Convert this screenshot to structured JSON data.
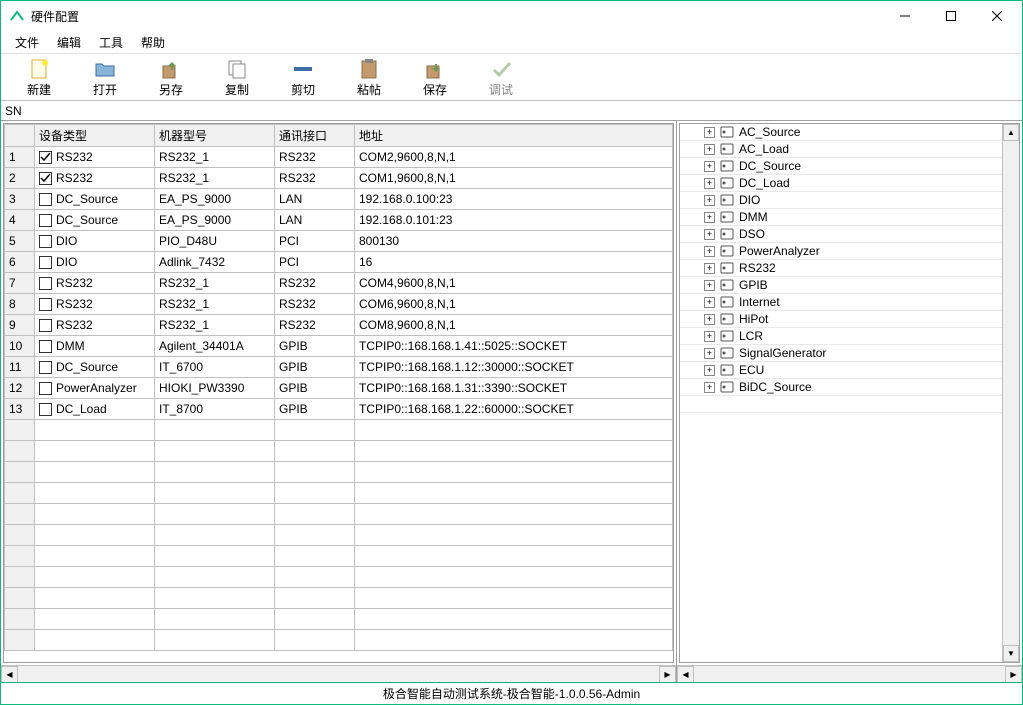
{
  "window": {
    "title": "硬件配置"
  },
  "menu": {
    "file": "文件",
    "edit": "编辑",
    "tool": "工具",
    "help": "帮助"
  },
  "toolbar": {
    "new": "新建",
    "open": "打开",
    "saveas": "另存",
    "copy": "复制",
    "cut": "剪切",
    "paste": "粘帖",
    "save": "保存",
    "debug": "调试"
  },
  "sn_label": "SN",
  "columns": {
    "type": "设备类型",
    "model": "机器型号",
    "comm": "通讯接口",
    "addr": "地址"
  },
  "rows": [
    {
      "n": "1",
      "checked": true,
      "type": "RS232",
      "model": "RS232_1",
      "comm": "RS232",
      "addr": "COM2,9600,8,N,1"
    },
    {
      "n": "2",
      "checked": true,
      "type": "RS232",
      "model": "RS232_1",
      "comm": "RS232",
      "addr": "COM1,9600,8,N,1"
    },
    {
      "n": "3",
      "checked": false,
      "type": "DC_Source",
      "model": "EA_PS_9000",
      "comm": "LAN",
      "addr": "192.168.0.100:23"
    },
    {
      "n": "4",
      "checked": false,
      "type": "DC_Source",
      "model": "EA_PS_9000",
      "comm": "LAN",
      "addr": "192.168.0.101:23"
    },
    {
      "n": "5",
      "checked": false,
      "type": "DIO",
      "model": "PIO_D48U",
      "comm": "PCI",
      "addr": "800130"
    },
    {
      "n": "6",
      "checked": false,
      "type": "DIO",
      "model": "Adlink_7432",
      "comm": "PCI",
      "addr": "16"
    },
    {
      "n": "7",
      "checked": false,
      "type": "RS232",
      "model": "RS232_1",
      "comm": "RS232",
      "addr": "COM4,9600,8,N,1"
    },
    {
      "n": "8",
      "checked": false,
      "type": "RS232",
      "model": "RS232_1",
      "comm": "RS232",
      "addr": "COM6,9600,8,N,1"
    },
    {
      "n": "9",
      "checked": false,
      "type": "RS232",
      "model": "RS232_1",
      "comm": "RS232",
      "addr": "COM8,9600,8,N,1"
    },
    {
      "n": "10",
      "checked": false,
      "type": "DMM",
      "model": "Agilent_34401A",
      "comm": "GPIB",
      "addr": "TCPIP0::168.168.1.41::5025::SOCKET"
    },
    {
      "n": "11",
      "checked": false,
      "type": "DC_Source",
      "model": "IT_6700",
      "comm": "GPIB",
      "addr": "TCPIP0::168.168.1.12::30000::SOCKET"
    },
    {
      "n": "12",
      "checked": false,
      "type": "PowerAnalyzer",
      "model": "HIOKI_PW3390",
      "comm": "GPIB",
      "addr": "TCPIP0::168.168.1.31::3390::SOCKET"
    },
    {
      "n": "13",
      "checked": false,
      "type": "DC_Load",
      "model": "IT_8700",
      "comm": "GPIB",
      "addr": "TCPIP0::168.168.1.22::60000::SOCKET"
    }
  ],
  "tree": [
    "AC_Source",
    "AC_Load",
    "DC_Source",
    "DC_Load",
    "DIO",
    "DMM",
    "DSO",
    "PowerAnalyzer",
    "RS232",
    "GPIB",
    "Internet",
    "HiPot",
    "LCR",
    "SignalGenerator",
    "ECU",
    "BiDC_Source"
  ],
  "status": "极合智能自动测试系统-极合智能-1.0.0.56-Admin"
}
